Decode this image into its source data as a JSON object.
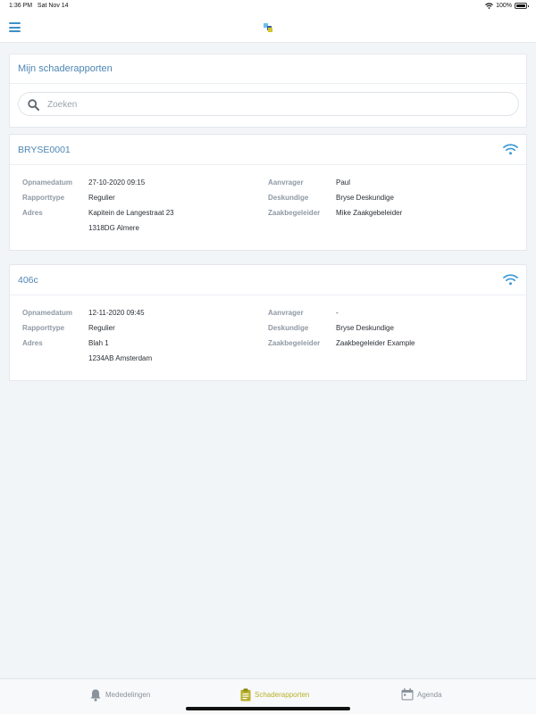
{
  "status_bar": {
    "time": "1:36 PM",
    "date": "Sat Nov 14",
    "battery": "100%"
  },
  "nav": {
    "menu_icon": "hamburger-icon",
    "logo": "app-logo"
  },
  "header": {
    "title": "Mijn schaderapporten",
    "search_placeholder": "Zoeken",
    "search_value": ""
  },
  "labels": {
    "opnamedatum": "Opnamedatum",
    "rapporttype": "Rapporttype",
    "adres": "Adres",
    "aanvrager": "Aanvrager",
    "deskundige": "Deskundige",
    "zaakbegeleider": "Zaakbegeleider"
  },
  "reports": [
    {
      "id": "BRYSE0001",
      "opnamedatum": "27-10-2020 09:15",
      "rapporttype": "Regulier",
      "adres_line1": "Kapitein de Langestraat 23",
      "adres_line2": "1318DG Almere",
      "aanvrager": "Paul",
      "deskundige": "Bryse Deskundige",
      "zaakbegeleider": "Mike Zaakgebeleider",
      "status_icon": "wifi-icon"
    },
    {
      "id": "406c",
      "opnamedatum": "12-11-2020 09:45",
      "rapporttype": "Regulier",
      "adres_line1": "Blah 1",
      "adres_line2": "1234AB Amsterdam",
      "aanvrager": "-",
      "deskundige": "Bryse Deskundige",
      "zaakbegeleider": "Zaakbegeleider Example",
      "status_icon": "wifi-icon"
    }
  ],
  "tabs": [
    {
      "label": "Mededelingen",
      "icon": "bell-icon",
      "active": false
    },
    {
      "label": "Schaderapporten",
      "icon": "clipboard-icon",
      "active": true
    },
    {
      "label": "Agenda",
      "icon": "calendar-icon",
      "active": false
    }
  ],
  "colors": {
    "accent_blue": "#4e86b3",
    "active_tab": "#b8b02a",
    "background": "#f2f5f8"
  }
}
